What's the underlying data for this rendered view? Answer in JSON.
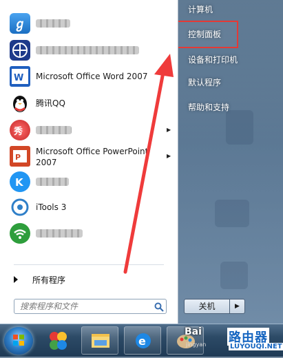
{
  "start_menu": {
    "pinned_programs": [
      {
        "label": "",
        "blurred": true,
        "icon": "app-icon-blue-9",
        "has_submenu": false
      },
      {
        "label": "",
        "blurred": true,
        "icon": "network-globe-icon",
        "has_submenu": false
      },
      {
        "label": "Microsoft Office Word 2007",
        "blurred": false,
        "icon": "word-2007-icon",
        "has_submenu": false
      },
      {
        "label": "腾讯QQ",
        "blurred": false,
        "icon": "qq-penguin-icon",
        "has_submenu": false
      },
      {
        "label": "",
        "blurred": true,
        "icon": "red-show-icon",
        "has_submenu": true
      },
      {
        "label": "Microsoft Office PowerPoint 2007",
        "blurred": false,
        "icon": "powerpoint-2007-icon",
        "has_submenu": true
      },
      {
        "label": "",
        "blurred": true,
        "icon": "k-circle-icon",
        "has_submenu": false
      },
      {
        "label": "iTools 3",
        "blurred": false,
        "icon": "itools-icon",
        "has_submenu": false
      },
      {
        "label": "",
        "blurred": true,
        "icon": "green-wifi-icon",
        "has_submenu": false
      }
    ],
    "all_programs_label": "所有程序",
    "search_placeholder": "搜索程序和文件",
    "right_items": [
      {
        "label": "计算机"
      },
      {
        "label": "控制面板"
      },
      {
        "label": "设备和打印机"
      },
      {
        "label": "默认程序"
      },
      {
        "label": "帮助和支持"
      }
    ],
    "shutdown_label": "关机",
    "shutdown_arrow": "▶"
  },
  "taskbar": {
    "items": [
      "start-orb-icon",
      "pinwheel-app-icon",
      "file-explorer-icon",
      "internet-explorer-icon",
      "paint-icon"
    ]
  },
  "watermark": {
    "brand": "Bai",
    "site_cn": "路由器",
    "site_en": "LUYOUQI.NET",
    "small": "jingyan"
  },
  "colors": {
    "highlight_box": "#e53935",
    "arrow": "#ef3b3b"
  }
}
